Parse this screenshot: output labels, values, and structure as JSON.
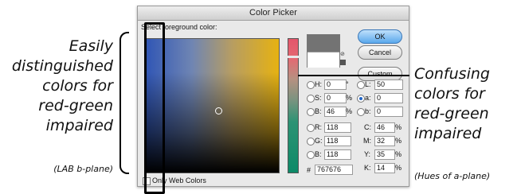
{
  "annotations": {
    "left_lines": [
      "Easily",
      "distinguished",
      "colors  for",
      "red-green",
      "impaired"
    ],
    "left_note": "(LAB b-plane)",
    "right_lines": [
      "Confusing",
      "colors for",
      "red-green",
      "impaired"
    ],
    "right_note": "(Hues of a-plane)"
  },
  "dialog": {
    "title": "Color Picker",
    "prompt": "Select foreground color:",
    "ok": "OK",
    "cancel": "Cancel",
    "custom": "Custom",
    "only_web_colors": "Only Web Colors",
    "hsb": {
      "h_label": "H:",
      "h": "0",
      "h_unit": "°",
      "s_label": "S:",
      "s": "0",
      "s_unit": "%",
      "b_label": "B:",
      "b": "46",
      "b_unit": "%"
    },
    "rgb": {
      "r_label": "R:",
      "r": "118",
      "g_label": "G:",
      "g": "118",
      "b_label": "B:",
      "b": "118"
    },
    "lab": {
      "l_label": "L:",
      "l": "50",
      "a_label": "a:",
      "a": "0",
      "b_label": "b:",
      "b": "0"
    },
    "cmyk": {
      "c_label": "C:",
      "c": "46",
      "m_label": "M:",
      "m": "32",
      "y_label": "Y:",
      "y": "35",
      "k_label": "K:",
      "k": "14",
      "unit": "%"
    },
    "hex_label": "#",
    "hex": "767676",
    "selected_radio": "a",
    "colors": {
      "new": "#737373",
      "current": "#ffffff"
    }
  }
}
